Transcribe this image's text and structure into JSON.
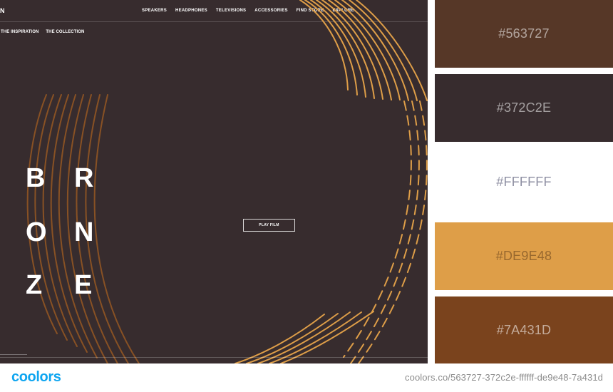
{
  "hero": {
    "brand_fragment": "N",
    "nav": [
      "SPEAKERS",
      "HEADPHONES",
      "TELEVISIONS",
      "ACCESSORIES",
      "FIND STORE",
      "EXPLORE"
    ],
    "subnav": [
      "THE INSPIRATION",
      "THE COLLECTION"
    ],
    "bronze_letters": [
      "B",
      "R",
      "O",
      "N",
      "Z",
      "E"
    ],
    "play_button": "PLAY FILM"
  },
  "palette": {
    "colors": [
      {
        "hex": "#563727",
        "label": "#563727"
      },
      {
        "hex": "#372C2E",
        "label": "#372C2E"
      },
      {
        "hex": "#FFFFFF",
        "label": "#FFFFFF"
      },
      {
        "hex": "#DE9E48",
        "label": "#DE9E48"
      },
      {
        "hex": "#7A431D",
        "label": "#7A431D"
      }
    ]
  },
  "footer": {
    "logo": "coolors",
    "url": "coolors.co/563727-372c2e-ffffff-de9e48-7a431d"
  }
}
